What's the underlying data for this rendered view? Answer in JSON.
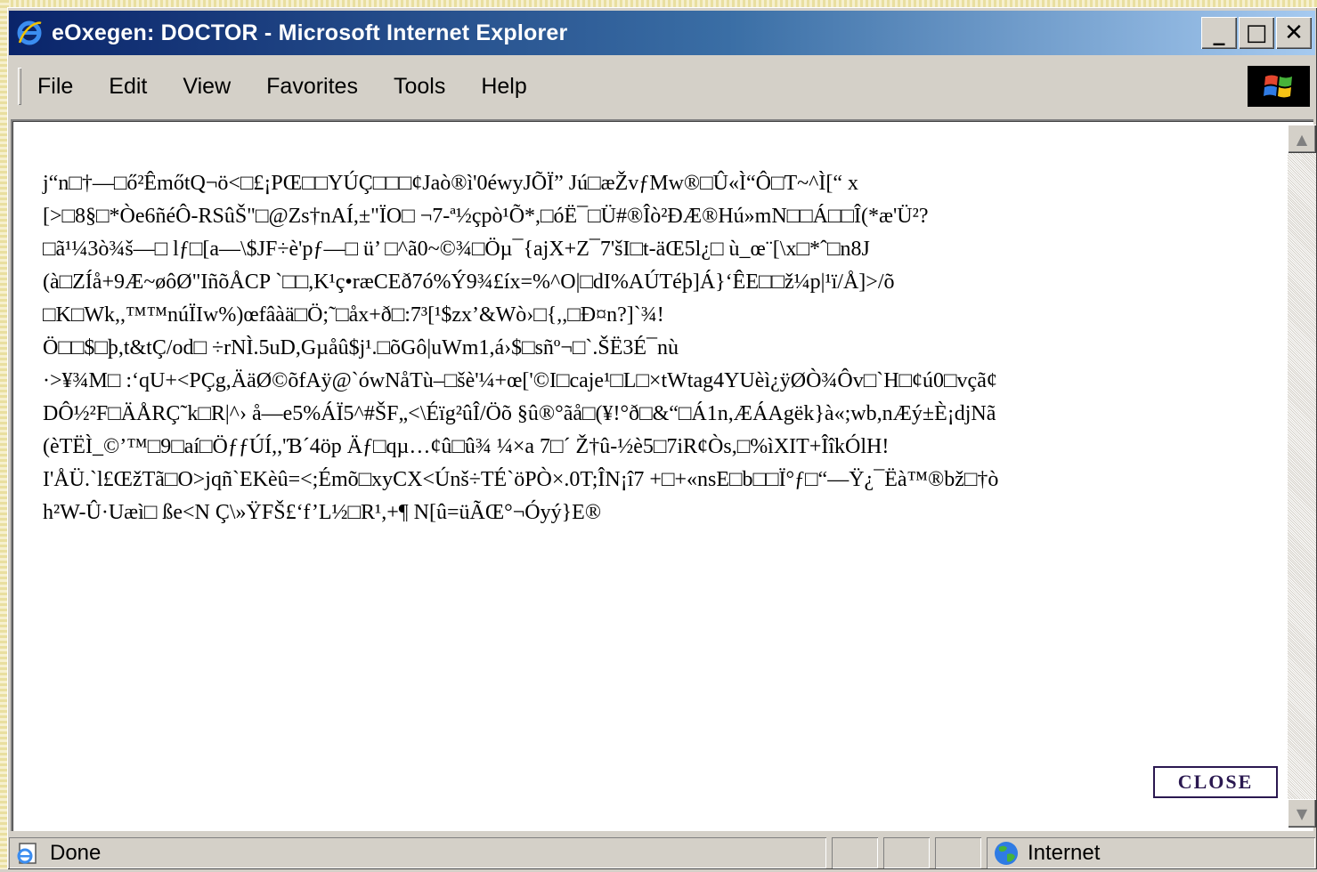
{
  "window": {
    "title": "eOxegen: DOCTOR - Microsoft Internet Explorer",
    "minimize_glyph": "_",
    "maximize_glyph": "□",
    "close_glyph": "✕"
  },
  "menu": {
    "items": [
      "File",
      "Edit",
      "View",
      "Favorites",
      "Tools",
      "Help"
    ]
  },
  "page": {
    "garbled_lines": [
      "j“n□†—□ő²ÊmőtQ¬ö<□£¡PŒ□□YÚÇ□□□¢Jaò®ì'0éwyJÕÏ” Jú□æŽvƒMw®□Û«Ì“Ô□T~^Ì[“ x",
      "[>□8§□*Òe6ñéÔ-RSûŠ\"□@Zs†nAÍ,±\"ÏO□ ¬7-ª½çpò¹Õ*,□óË¯□Ü#®Îò²ÐÆ®Hú»mN□□Á□□Î(*æ'Ü²?",
      "□ã¹¼3ò¾š—□ lƒ□[a—\\$JF÷è'pƒ—□ ü’ □^ã0~©¾□Öµ¯{ajX+Z¯7'šI□t-äŒ5l¿□ ù_œ¨[\\x□*ˆ□n8J",
      "(à□ZÍå+9Æ~øôØ\"IñõÅCP `□□,K¹ç•ræCEð7ó%Ý9¾£íx=%^O|□dI%AÚTéþ]Á}‘ÊE□□ž¼p|¹ï/Å]>/õ",
      "□K□Wk,,™™núÏIw%)œfâàä□Ö;˜□åx+ð□:7³[¹$zx’&Wò›□{,,□Ð¤n?]`¾!",
      "Ö□□$□þ,t&tÇ/od□ ÷rNÌ.5uD,Gµåû$j¹.□õGô|uWm1,á›$□sñº¬□`.ŠË3É¯nù",
      "·>¥¾M□ :‘qU+<PÇg,ÄäØ©õfAÿ@`ówNåTù–□šè'¼+œ['©I□caje¹□L□×tWtag4YUèì¿ÿØÒ¾Ôv□`H□¢ú0□vçã¢",
      "DÔ½²F□ÄÅRÇ˜k□R|^› å—e5%ÁÏ5^#ŠF„<\\Éïg²ûÎ/Öõ §û®°ãå□(¥!°ð□&“□Á1n,ÆÁAgëk}à«;wb,nÆý±È¡djNã",
      "(èTËÌ_©’™□9□aí□ÖƒƒÚÍ,,'Ɓ´4öp Äƒ□qµ…¢û□û¾ ¼×a 7□´ Ž†û-½è5□7iR¢Òs,□%ìXIT+ÎîkÓlH!",
      "I'ÅÜ.`l£ŒžTã□O>jqñ`EKèû=<;Émõ□xyCX<Únš÷TÉ`öPÒ×.0T;ÎN¡î7 +□+«nsE□b□□Ï°ƒ□“—Ÿ¿¯Ëà™®bž□†ò",
      "h²W-Û·Uæì□ ße<N Ç\\»ŸFŠ£‘f’L½□R¹,+¶ N[û=üÃŒ°¬Óyý}E®"
    ],
    "close_label": "CLOSE"
  },
  "status": {
    "text": "Done",
    "zone": "Internet"
  },
  "colors": {
    "titlebar_start": "#0a246a",
    "titlebar_end": "#a6caf0",
    "close_button": "#2a1850"
  },
  "icons": {
    "title": "ie-logo-icon",
    "status": "page-done-icon",
    "zone": "internet-globe-icon",
    "throbber": "windows-logo-icon"
  }
}
